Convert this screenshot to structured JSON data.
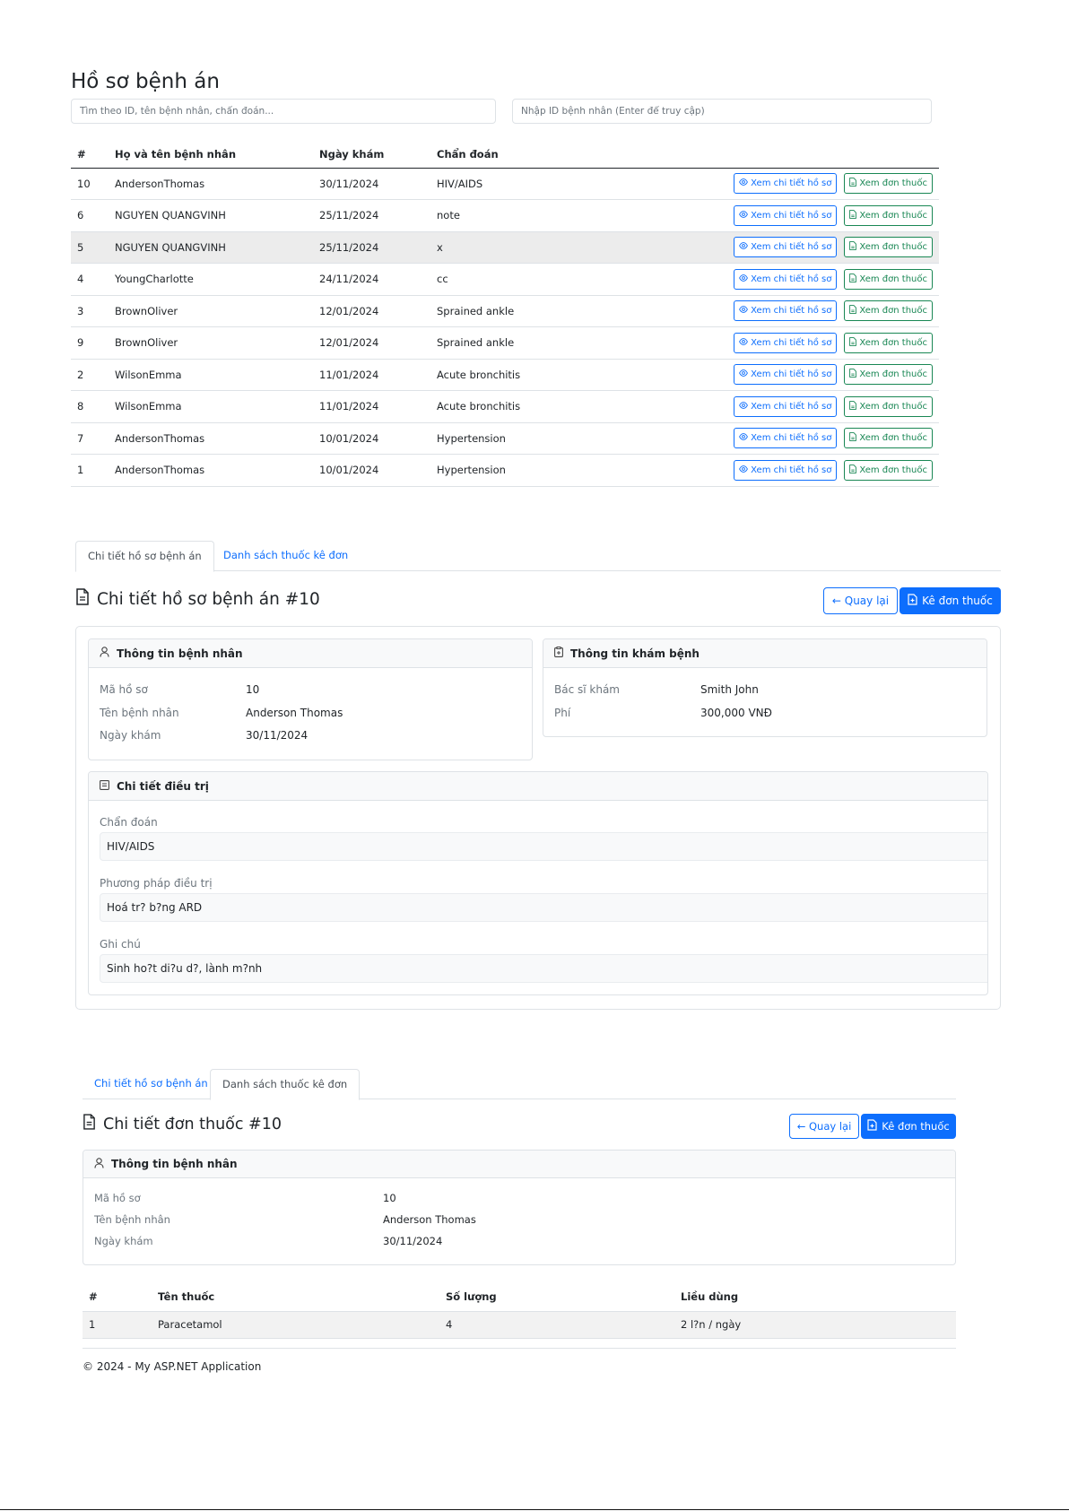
{
  "list": {
    "title": "Hồ sơ bệnh án",
    "search_placeholder": "Tìm theo ID, tên bệnh nhân, chẩn đoán...",
    "id_placeholder": "Nhập ID bệnh nhân (Enter để truy cập)",
    "columns": [
      "#",
      "Họ và tên bệnh nhân",
      "Ngày khám",
      "Chẩn đoán"
    ],
    "view_label": "Xem chi tiết hồ sơ",
    "rx_label": "Xem đơn thuốc",
    "rows": [
      {
        "id": "10",
        "name": "AndersonThomas",
        "date": "30/11/2024",
        "diagnosis": "HIV/AIDS"
      },
      {
        "id": "6",
        "name": "NGUYEN QUANGVINH",
        "date": "25/11/2024",
        "diagnosis": "note"
      },
      {
        "id": "5",
        "name": "NGUYEN QUANGVINH",
        "date": "25/11/2024",
        "diagnosis": "x"
      },
      {
        "id": "4",
        "name": "YoungCharlotte",
        "date": "24/11/2024",
        "diagnosis": "cc"
      },
      {
        "id": "3",
        "name": "BrownOliver",
        "date": "12/01/2024",
        "diagnosis": "Sprained ankle"
      },
      {
        "id": "9",
        "name": "BrownOliver",
        "date": "12/01/2024",
        "diagnosis": "Sprained ankle"
      },
      {
        "id": "2",
        "name": "WilsonEmma",
        "date": "11/01/2024",
        "diagnosis": "Acute bronchitis"
      },
      {
        "id": "8",
        "name": "WilsonEmma",
        "date": "11/01/2024",
        "diagnosis": "Acute bronchitis"
      },
      {
        "id": "7",
        "name": "AndersonThomas",
        "date": "10/01/2024",
        "diagnosis": "Hypertension"
      },
      {
        "id": "1",
        "name": "AndersonThomas",
        "date": "10/01/2024",
        "diagnosis": "Hypertension"
      }
    ]
  },
  "tabs": {
    "detail": "Chi tiết hồ sơ bệnh án",
    "prescription": "Danh sách thuốc kê đơn"
  },
  "detail": {
    "heading": "Chi tiết hồ sơ bệnh án #10",
    "back_label": "← Quay lại",
    "prescribe_label": "Kê đơn thuốc",
    "patient_card": {
      "title": "Thông tin bệnh nhân",
      "fields": [
        {
          "label": "Mã hồ sơ",
          "value": "10"
        },
        {
          "label": "Tên bệnh nhân",
          "value": "Anderson Thomas"
        },
        {
          "label": "Ngày khám",
          "value": "30/11/2024"
        }
      ]
    },
    "exam_card": {
      "title": "Thông tin khám bệnh",
      "fields": [
        {
          "label": "Bác sĩ khám",
          "value": "Smith John"
        },
        {
          "label": "Phí",
          "value": "300,000 VNĐ"
        }
      ]
    },
    "treatment_card": {
      "title": "Chi tiết điều trị",
      "diagnosis_label": "Chẩn đoán",
      "diagnosis_value": "HIV/AIDS",
      "method_label": "Phương pháp điều trị",
      "method_value": "Hoá tr? b?ng ARD",
      "notes_label": "Ghi chú",
      "notes_value": "Sinh ho?t di?u d?, lành m?nh"
    }
  },
  "prescription": {
    "heading": "Chi tiết đơn thuốc #10",
    "back_label": "← Quay lại",
    "prescribe_label": "Kê đơn thuốc",
    "patient_card": {
      "title": "Thông tin bệnh nhân",
      "fields": [
        {
          "label": "Mã hồ sơ",
          "value": "10"
        },
        {
          "label": "Tên bệnh nhân",
          "value": "Anderson Thomas"
        },
        {
          "label": "Ngày khám",
          "value": "30/11/2024"
        }
      ]
    },
    "columns": [
      "#",
      "Tên thuốc",
      "Số lượng",
      "Liều dùng"
    ],
    "rows": [
      {
        "no": "1",
        "drug": "Paracetamol",
        "qty": "4",
        "dosage": "2 l?n / ngày"
      }
    ]
  },
  "footer": "© 2024 - My ASP.NET Application",
  "colors": {
    "primary": "#0d6efd",
    "success": "#198754",
    "border": "#dee2e6"
  }
}
